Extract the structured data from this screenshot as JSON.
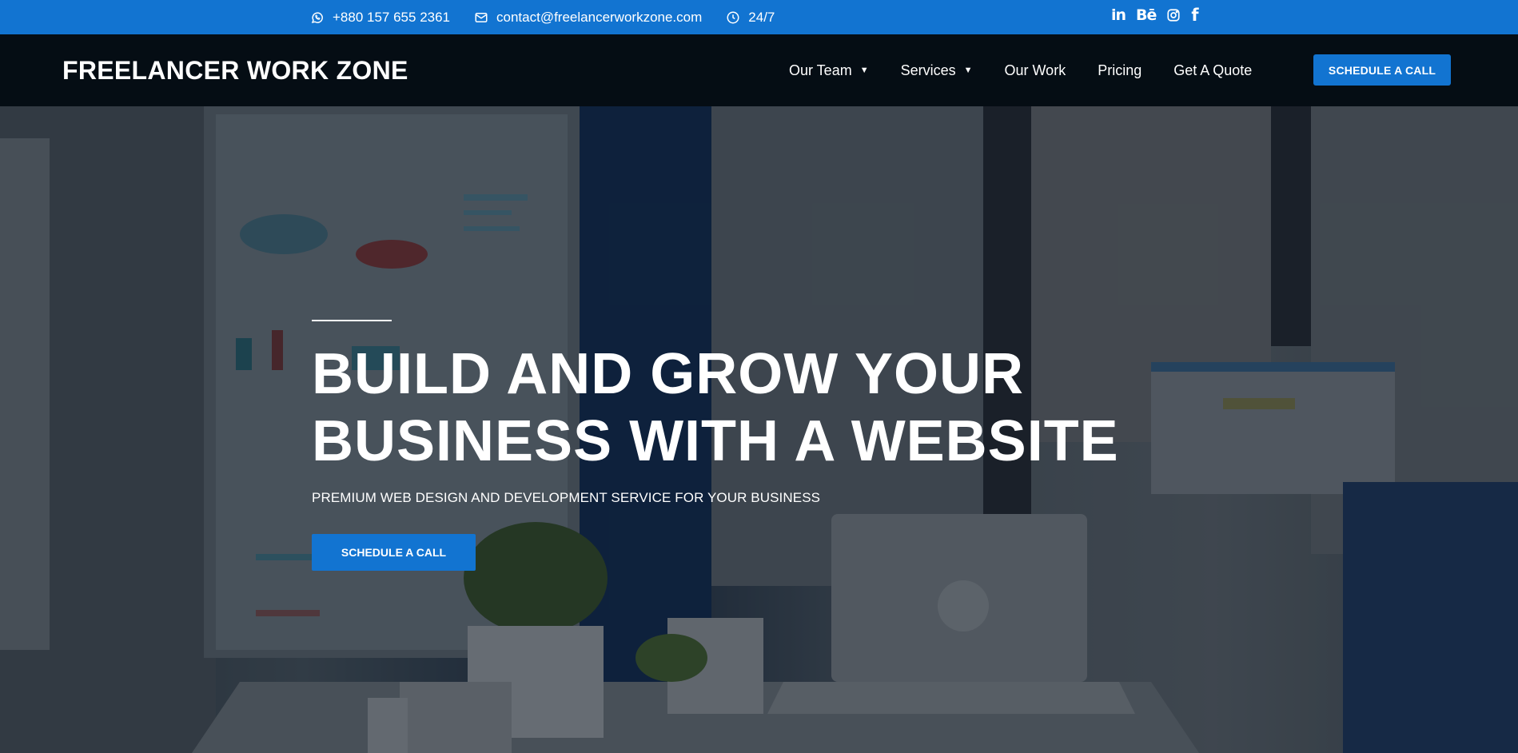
{
  "topbar": {
    "phone": "+880 157 655 2361",
    "email": "contact@freelancerworkzone.com",
    "hours": "24/7",
    "social": [
      {
        "icon": "linkedin-icon",
        "glyph": "in"
      },
      {
        "icon": "behance-icon",
        "glyph": "Bē"
      },
      {
        "icon": "instagram-icon"
      },
      {
        "icon": "facebook-icon",
        "glyph": "f"
      }
    ]
  },
  "nav": {
    "brand": "FREELANCER WORK ZONE",
    "menu": [
      {
        "label": "Our Team",
        "has_dropdown": true
      },
      {
        "label": "Services",
        "has_dropdown": true
      },
      {
        "label": "Our Work",
        "has_dropdown": false
      },
      {
        "label": "Pricing",
        "has_dropdown": false
      },
      {
        "label": "Get A Quote",
        "has_dropdown": false
      }
    ],
    "cta": "SCHEDULE A CALL"
  },
  "hero": {
    "title_line1": "BUILD AND GROW YOUR",
    "title_line2": "BUSINESS WITH A WEBSITE",
    "subtitle": "PREMIUM WEB DESIGN AND DEVELOPMENT SERVICE FOR YOUR BUSINESS",
    "cta": "SCHEDULE A CALL"
  },
  "colors": {
    "accent": "#1274d1",
    "nav_bg": "#050d14"
  }
}
